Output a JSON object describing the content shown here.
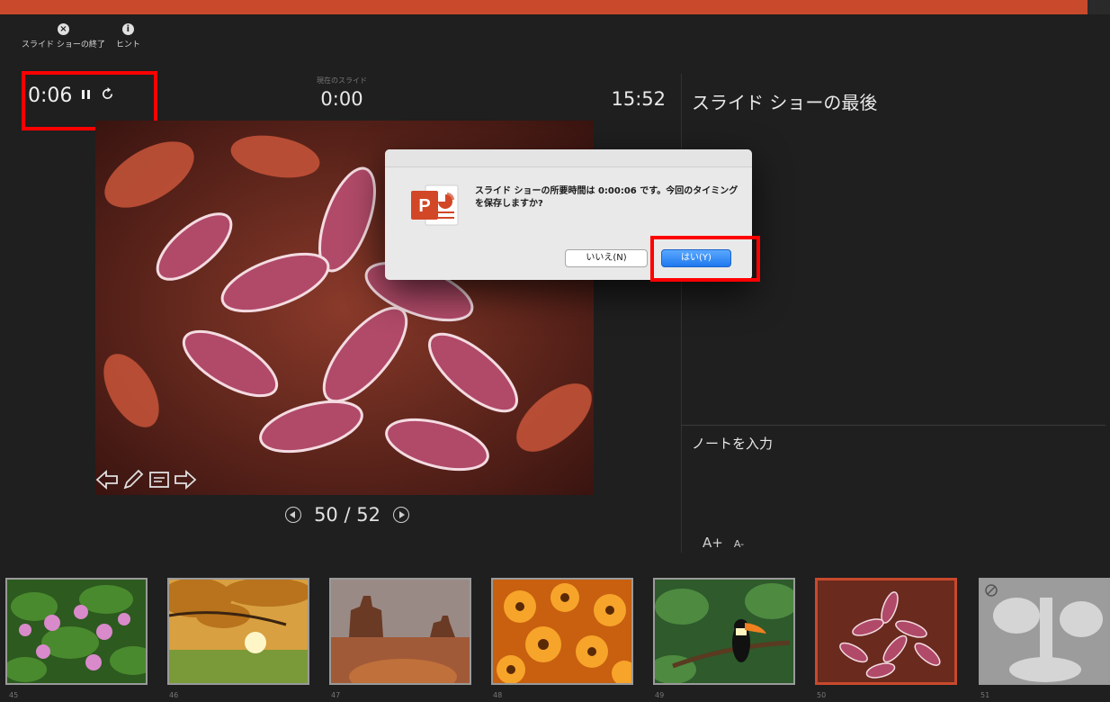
{
  "progress_percent": 98,
  "toolbar": {
    "end_show_label": "スライド ショーの終了",
    "hint_label": "ヒント"
  },
  "timer": {
    "elapsed": "0:06"
  },
  "current_slide": {
    "label": "現在のスライド",
    "time": "0:00"
  },
  "clock": "15:52",
  "next_slide": {
    "title": "スライド ショーの最後"
  },
  "slide_nav": {
    "counter": "50 / 52"
  },
  "notes": {
    "label": "ノートを入力"
  },
  "font_controls": {
    "increase": "A+",
    "decrease": "A-"
  },
  "dialog": {
    "message": "スライド ショーの所要時間は 0:00:06 です。今回のタイミングを保存しますか?",
    "no_label": "いいえ(N)",
    "yes_label": "はい(Y)"
  },
  "filmstrip": {
    "thumbnails": [
      {
        "number": "45"
      },
      {
        "number": "46"
      },
      {
        "number": "47"
      },
      {
        "number": "48"
      },
      {
        "number": "49"
      },
      {
        "number": "50"
      },
      {
        "number": "51"
      }
    ]
  },
  "colors": {
    "accent": "#c8492c",
    "highlight": "#ff0000",
    "primary_button": "#1f78ee",
    "background": "#1f1f1f"
  }
}
